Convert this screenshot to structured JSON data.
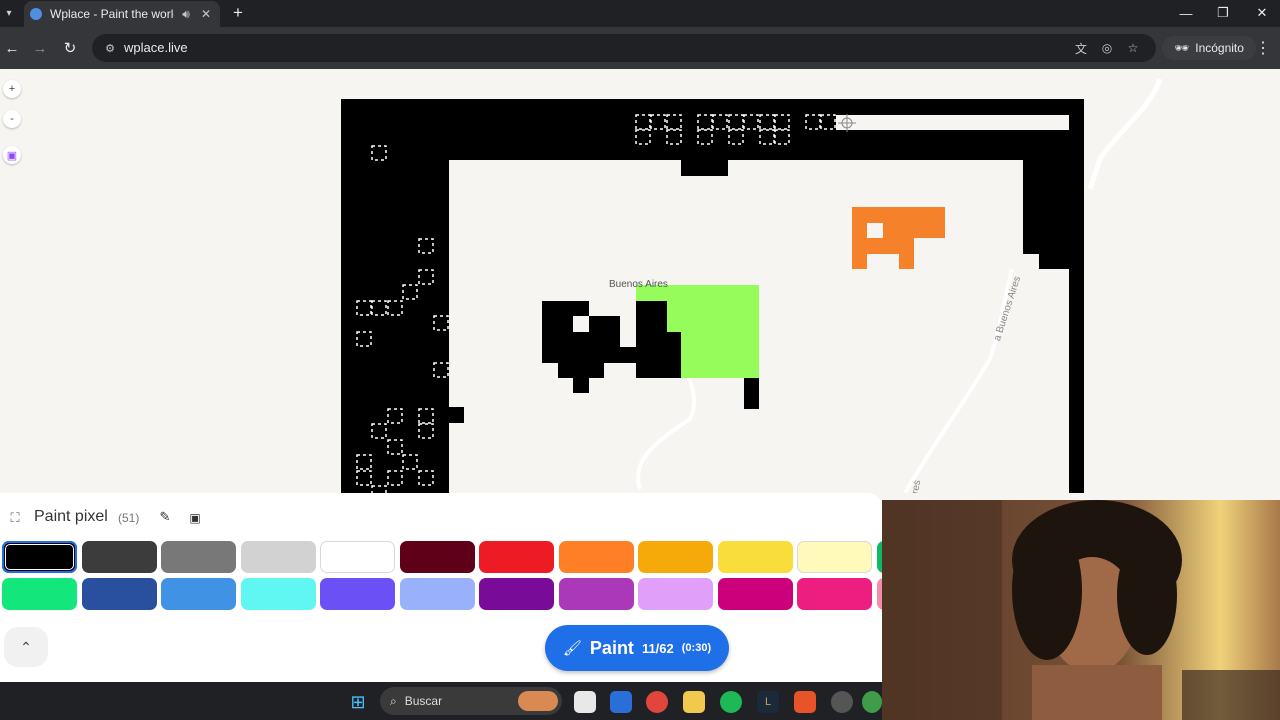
{
  "browser": {
    "tab_title": "Wplace - Paint the world",
    "url": "wplace.live",
    "incognito_label": "Incógnito",
    "new_tab_symbol": "+",
    "tab_close_symbol": "✕"
  },
  "map": {
    "controls": {
      "zoom_in": "+",
      "zoom_out": "-"
    },
    "labels": {
      "city": "Buenos Aires",
      "street": "a Buenos Aires",
      "street_cut": "res"
    }
  },
  "panel": {
    "title": "Paint pixel",
    "count": "(51)",
    "palette": [
      {
        "color": "#000000",
        "selected": true
      },
      {
        "color": "#3c3c3c"
      },
      {
        "color": "#787878"
      },
      {
        "color": "#d2d2d2"
      },
      {
        "color": "#ffffff"
      },
      {
        "color": "#600018"
      },
      {
        "color": "#ed1c24"
      },
      {
        "color": "#ff7f27"
      },
      {
        "color": "#f6aa09"
      },
      {
        "color": "#f9dd3b"
      },
      {
        "color": "#fffabc"
      },
      {
        "color": "#0eb968"
      },
      {
        "color": "#13e67b"
      },
      {
        "color": "#28509e"
      },
      {
        "color": "#4093e4"
      },
      {
        "color": "#60f7f2"
      },
      {
        "color": "#6b50f6"
      },
      {
        "color": "#99b1fb"
      },
      {
        "color": "#780c99"
      },
      {
        "color": "#aa38b9"
      },
      {
        "color": "#e09ff9"
      },
      {
        "color": "#cb007a"
      },
      {
        "color": "#ec1f80"
      },
      {
        "color": "#f38da9"
      }
    ],
    "paint_button": {
      "label": "Paint",
      "charges": "11/62",
      "timer": "(0:30)"
    }
  },
  "taskbar": {
    "search_label": "Buscar"
  },
  "colors": {
    "accent": "#1f6fe8",
    "paint_orange": "#f5822a",
    "paint_green": "#95fc5b"
  }
}
